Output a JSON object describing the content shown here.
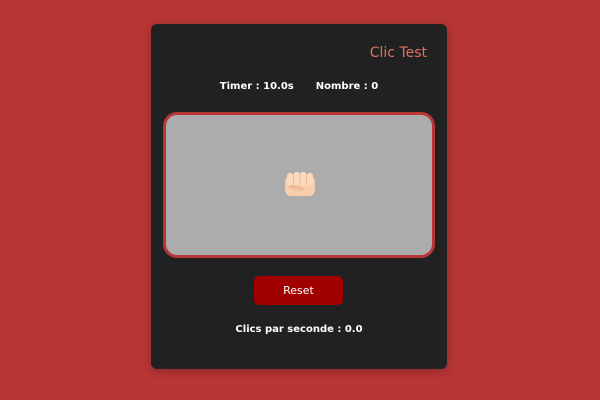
{
  "app": {
    "title": "Clic Test"
  },
  "stats": {
    "timer": "Timer : 10.0s",
    "count": "Nombre : 0"
  },
  "click_area": {
    "icon": "fist-bump-icon"
  },
  "buttons": {
    "reset_label": "Reset"
  },
  "result": {
    "cps": "Clics par seconde : 0.0"
  },
  "colors": {
    "background": "#b83636",
    "card": "#212121",
    "title": "#e07060",
    "click_area": "#acacac",
    "click_area_border": "#b83636",
    "reset_button": "#a00000"
  }
}
